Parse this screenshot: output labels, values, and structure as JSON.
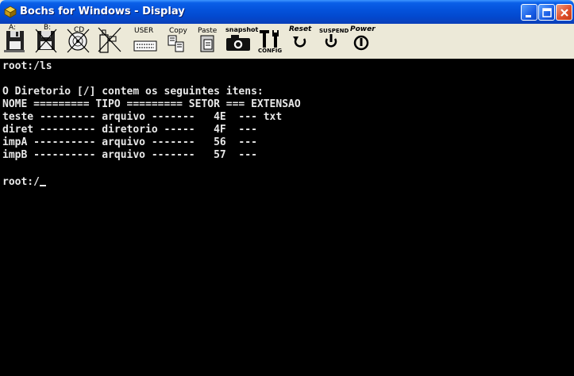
{
  "window": {
    "title": "Bochs for Windows - Display",
    "controls": [
      "minimize-icon",
      "maximize-icon",
      "close-icon"
    ]
  },
  "toolbar": {
    "floppy_a_label": "A:",
    "floppy_b_label": "B:",
    "cdrom_label": "CD",
    "user_label": "USER",
    "copy_label": "Copy",
    "paste_label": "Paste",
    "snapshot_label": "snapshot",
    "config_label": "CONFIG",
    "reset_label": "Reset",
    "suspend_label": "SUSPEND",
    "power_label": "Power"
  },
  "console": {
    "lines": [
      "root:/ls",
      "",
      "O Diretorio [/] contem os seguintes itens:",
      "NOME ========= TIPO ========= SETOR === EXTENSAO",
      "teste --------- arquivo -------   4E  --- txt",
      "diret --------- diretorio -----   4F  ---",
      "impA ---------- arquivo -------   56  ---",
      "impB ---------- arquivo -------   57  ---",
      "",
      "root:/"
    ]
  },
  "colors": {
    "titlebar": "#0453dc",
    "console_bg": "#000000",
    "console_fg": "#e8e8e8",
    "toolbar_bg": "#ece9d8"
  }
}
